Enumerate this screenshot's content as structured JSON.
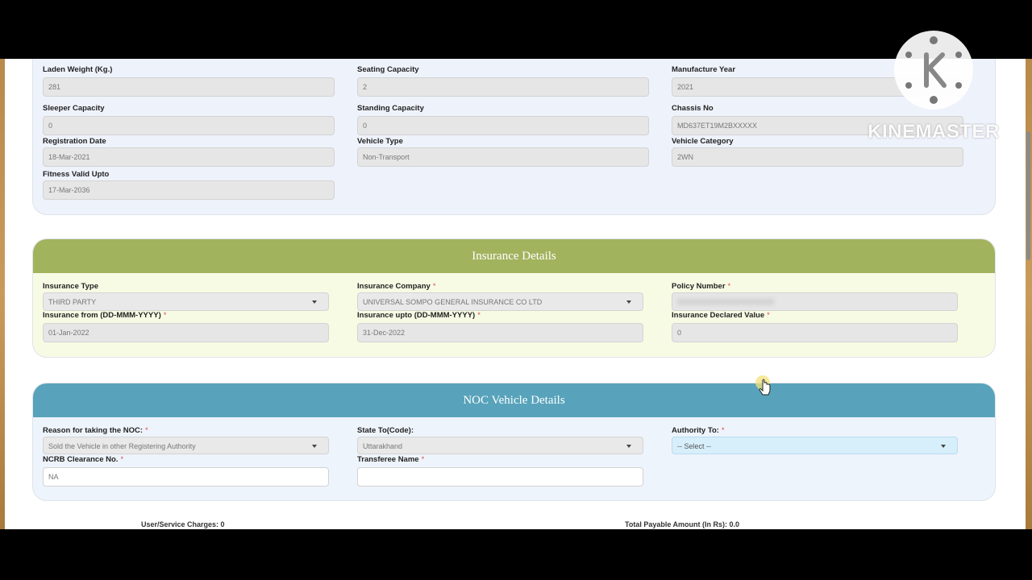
{
  "vehicle": {
    "laden_weight": {
      "label": "Laden Weight (Kg.)",
      "value": "281"
    },
    "seating_capacity": {
      "label": "Seating Capacity",
      "value": "2"
    },
    "manufacture_year": {
      "label": "Manufacture Year",
      "value": "2021"
    },
    "sleeper_capacity": {
      "label": "Sleeper Capacity",
      "value": "0"
    },
    "standing_capacity": {
      "label": "Standing Capacity",
      "value": "0"
    },
    "chassis_no": {
      "label": "Chassis No",
      "value": "MD637ET19M2BXXXXX"
    },
    "registration_date": {
      "label": "Registration Date",
      "value": "18-Mar-2021"
    },
    "vehicle_type": {
      "label": "Vehicle Type",
      "value": "Non-Transport"
    },
    "vehicle_category": {
      "label": "Vehicle Category",
      "value": "2WN"
    },
    "fitness_valid_upto": {
      "label": "Fitness Valid Upto",
      "value": "17-Mar-2036"
    }
  },
  "insurance": {
    "title": "Insurance Details",
    "type": {
      "label": "Insurance Type",
      "value": "THIRD PARTY"
    },
    "company": {
      "label": "Insurance Company",
      "value": "UNIVERSAL SOMPO GENERAL INSURANCE CO LTD"
    },
    "policy_number": {
      "label": "Policy Number",
      "value": "XXXXXXXXXXXXXXXXXXXX"
    },
    "from": {
      "label": "Insurance from (DD-MMM-YYYY)",
      "value": "01-Jan-2022"
    },
    "upto": {
      "label": "Insurance upto (DD-MMM-YYYY)",
      "value": "31-Dec-2022"
    },
    "declared_value": {
      "label": "Insurance Declared Value",
      "value": "0"
    }
  },
  "noc": {
    "title": "NOC Vehicle Details",
    "reason": {
      "label": "Reason for taking the NOC:",
      "value": "Sold the Vehicle in other Registering Authority"
    },
    "state_to": {
      "label": "State To(Code):",
      "value": "Uttarakhand"
    },
    "authority_to": {
      "label": "Authority To:",
      "value": "-- Select --"
    },
    "ncrb": {
      "label": "NCRB Clearance No.",
      "value": "NA"
    },
    "transferee": {
      "label": "Transferee Name",
      "value": ""
    }
  },
  "footer": {
    "service_charges": "User/Service Charges: 0",
    "total_payable": "Total Payable Amount (In Rs): 0.0"
  },
  "watermark": {
    "text": "KINEMASTER",
    "icon": "kinemaster-logo-icon"
  },
  "colors": {
    "insurance_header": "#a2b35e",
    "noc_header": "#58a3bb"
  }
}
